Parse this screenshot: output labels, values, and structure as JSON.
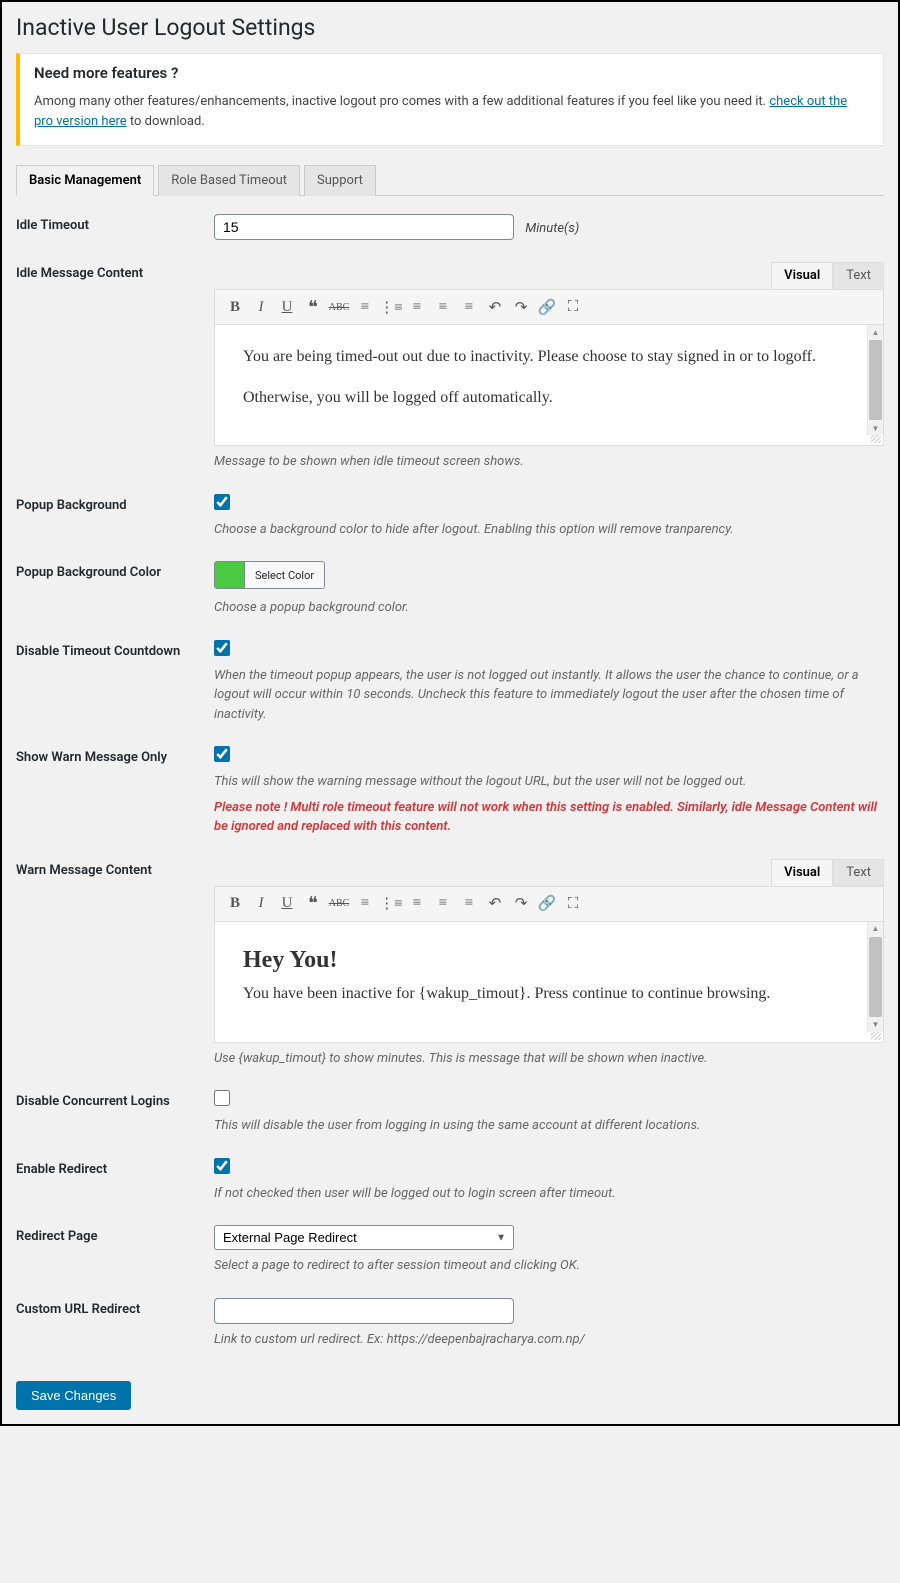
{
  "page_title": "Inactive User Logout Settings",
  "notice": {
    "heading": "Need more features ?",
    "text_pre": "Among many other features/enhancements, inactive logout pro comes with a few additional features if you feel like you need it. ",
    "link": "check out the pro version here",
    "text_post": " to download."
  },
  "tabs": [
    "Basic Management",
    "Role Based Timeout",
    "Support"
  ],
  "editor_tabs": {
    "visual": "Visual",
    "text": "Text"
  },
  "fields": {
    "idle_timeout": {
      "label": "Idle Timeout",
      "value": "15",
      "suffix": "Minute(s)"
    },
    "idle_message": {
      "label": "Idle Message Content",
      "content_p1": "You are being timed-out out due to inactivity. Please choose to stay signed in or to logoff.",
      "content_p2": "Otherwise, you will be logged off automatically.",
      "description": "Message to be shown when idle timeout screen shows."
    },
    "popup_bg": {
      "label": "Popup Background",
      "checked": true,
      "description": "Choose a background color to hide after logout. Enabling this option will remove tranparency."
    },
    "popup_bg_color": {
      "label": "Popup Background Color",
      "button": "Select Color",
      "color": "#4bc940",
      "description": "Choose a popup background color."
    },
    "disable_countdown": {
      "label": "Disable Timeout Countdown",
      "checked": true,
      "description": "When the timeout popup appears, the user is not logged out instantly. It allows the user the chance to continue, or a logout will occur within 10 seconds. Uncheck this feature to immediately logout the user after the chosen time of inactivity."
    },
    "show_warn_only": {
      "label": "Show Warn Message Only",
      "checked": true,
      "description": "This will show the warning message without the logout URL, but the user will not be logged out.",
      "warning": "Please note ! Multi role timeout feature will not work when this setting is enabled. Similarly, idle Message Content will be ignored and replaced with this content."
    },
    "warn_message": {
      "label": "Warn Message Content",
      "heading": "Hey You!",
      "content": "You have been inactive for {wakup_timout}. Press continue to continue browsing.",
      "description": "Use {wakup_timout} to show minutes. This is message that will be shown when inactive."
    },
    "disable_concurrent": {
      "label": "Disable Concurrent Logins",
      "checked": false,
      "description": "This will disable the user from logging in using the same account at different locations."
    },
    "enable_redirect": {
      "label": "Enable Redirect",
      "checked": true,
      "description": "If not checked then user will be logged out to login screen after timeout."
    },
    "redirect_page": {
      "label": "Redirect Page",
      "selected": "External Page Redirect",
      "description": "Select a page to redirect to after session timeout and clicking OK."
    },
    "custom_url": {
      "label": "Custom URL Redirect",
      "value": "",
      "description": "Link to custom url redirect. Ex: https://deepenbajracharya.com.np/"
    }
  },
  "submit": "Save Changes"
}
